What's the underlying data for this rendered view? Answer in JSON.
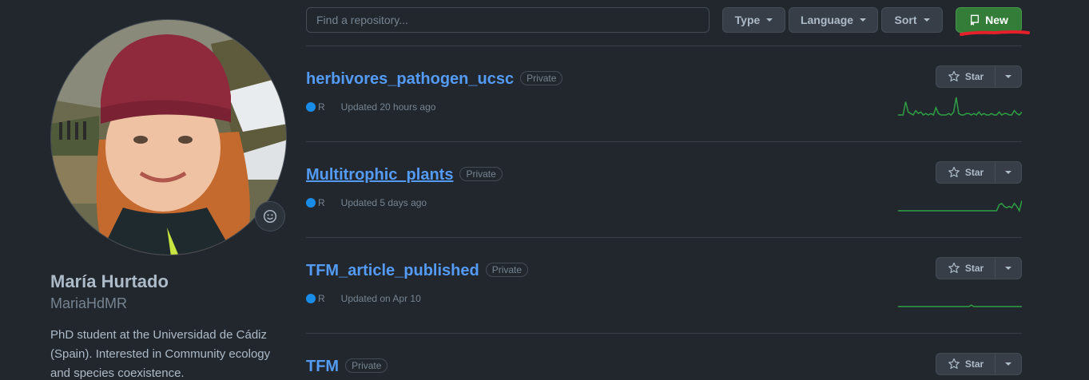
{
  "profile": {
    "full_name": "María Hurtado",
    "username": "MariaHdMR",
    "bio": "PhD student at the Universidad de Cádiz (Spain). Interested in Community ecology and species coexistence."
  },
  "toolbar": {
    "search_placeholder": "Find a repository...",
    "type_label": "Type",
    "language_label": "Language",
    "sort_label": "Sort",
    "new_label": "New"
  },
  "colors": {
    "accent_link": "#539bf5",
    "new_button": "#347d39",
    "lang_r": "#198ce7",
    "annotation": "#e5202a",
    "sparkline": "#2ea043"
  },
  "repos": [
    {
      "name": "herbivores_pathogen_ucsc",
      "visibility": "Private",
      "language": "R",
      "updated": "Updated 20 hours ago",
      "star_label": "Star",
      "activity": [
        0,
        0,
        0,
        9,
        2,
        1,
        0,
        3,
        1,
        2,
        0,
        1,
        0,
        1,
        0,
        5,
        1,
        0,
        0,
        0,
        1,
        0,
        2,
        12,
        1,
        0,
        0,
        1,
        1,
        0,
        1,
        0,
        2,
        0,
        1,
        0,
        0,
        1,
        0,
        0,
        2,
        0,
        1,
        1,
        0,
        0,
        3,
        1,
        0,
        2
      ]
    },
    {
      "name": "Multitrophic_plants",
      "visibility": "Private",
      "language": "R",
      "updated": "Updated 5 days ago",
      "star_label": "Star",
      "activity": [
        0,
        0,
        0,
        0,
        0,
        0,
        0,
        0,
        0,
        0,
        0,
        0,
        0,
        0,
        0,
        0,
        0,
        0,
        0,
        0,
        0,
        0,
        0,
        0,
        0,
        0,
        0,
        0,
        0,
        0,
        0,
        0,
        0,
        0,
        0,
        0,
        0,
        0,
        0,
        0,
        4,
        5,
        3,
        2,
        3,
        2,
        5,
        3,
        0,
        7
      ]
    },
    {
      "name": "TFM_article_published",
      "visibility": "Private",
      "language": "R",
      "updated": "Updated on Apr 10",
      "star_label": "Star",
      "activity": [
        0,
        0,
        0,
        0,
        0,
        0,
        0,
        0,
        0,
        0,
        0,
        0,
        0,
        0,
        0,
        0,
        0,
        0,
        0,
        0,
        0,
        0,
        0,
        0,
        0,
        0,
        0,
        0,
        0,
        1,
        0,
        0,
        0,
        0,
        0,
        0,
        0,
        0,
        0,
        0,
        0,
        0,
        0,
        0,
        0,
        0,
        0,
        0,
        0,
        0
      ]
    },
    {
      "name": "TFM",
      "visibility": "Private",
      "star_label": "Star"
    }
  ]
}
